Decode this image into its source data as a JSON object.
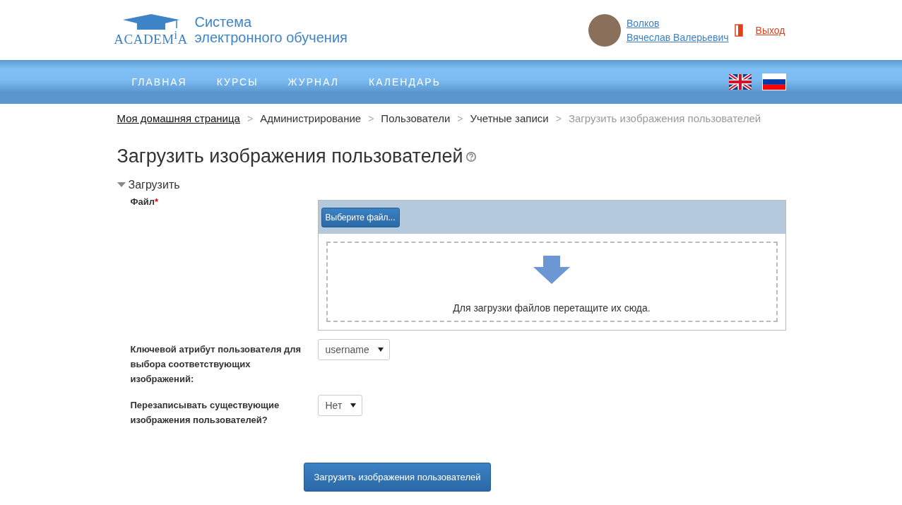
{
  "header": {
    "logo": "ACADEM$^{i}$A",
    "site_title": [
      "Система",
      "электронного обучения"
    ],
    "user": {
      "name_lines": [
        "Волков",
        "Вячеслав Валерьевич"
      ]
    },
    "logout": "Выход"
  },
  "nav": {
    "items": [
      {
        "label": "ГЛАВНАЯ"
      },
      {
        "label": "КУРСЫ"
      },
      {
        "label": "ЖУРНАЛ"
      },
      {
        "label": "КАЛЕНДАРЬ"
      }
    ],
    "languages": [
      {
        "kind": "uk",
        "selected": false
      },
      {
        "kind": "ru",
        "selected": true
      }
    ]
  },
  "breadcrumb": [
    {
      "label": "Моя домашняя страница",
      "link": true
    },
    {
      "separator": ">",
      "label": "Администрирование",
      "link": false
    },
    {
      "separator": ">",
      "label": "Пользователи",
      "link": false
    },
    {
      "separator": ">",
      "label": "Учетные записи",
      "link": false
    },
    {
      "separator": ">",
      "label": "Загрузить изображения пользователей",
      "link": false,
      "current": true
    }
  ],
  "page_title": "Загрузить изображения пользователей",
  "section": {
    "title": "Загрузить",
    "expanded": true
  },
  "form": {
    "file": {
      "label": "Файл",
      "required_mark": "*",
      "button": "Выберите файл...",
      "drop_hint": "Для загрузки файлов перетащите их сюда."
    },
    "selects": [
      {
        "label": "Ключевой атрибут пользователя для выбора соответствующих изображений:",
        "value": "username"
      },
      {
        "label": "Перезаписывать существующие изображения пользователей?",
        "value": "Нет"
      }
    ],
    "submit": "Загрузить изображения пользователей"
  }
}
